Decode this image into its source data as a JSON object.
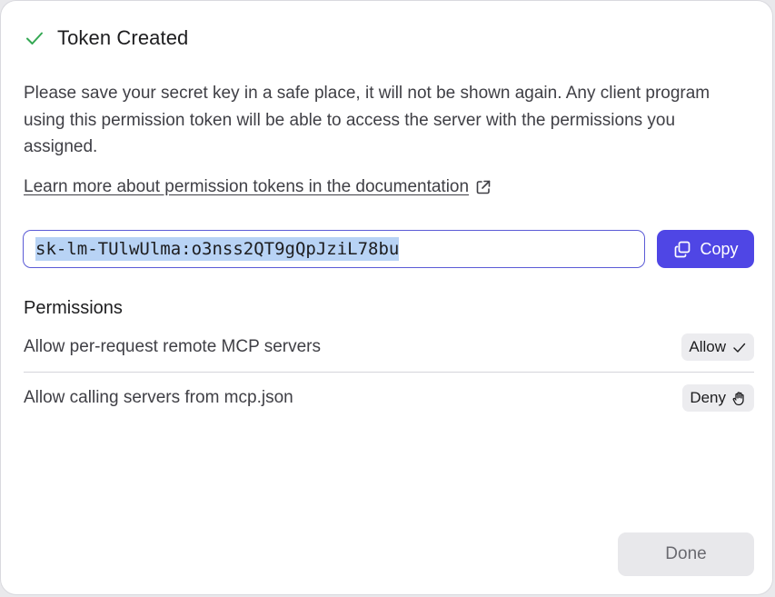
{
  "dialog": {
    "title": "Token Created",
    "title_icon": "check-icon",
    "description": "Please save your secret key in a safe place, it will not be shown again. Any client program using this permission token will be able to access the server with the permissions you assigned.",
    "doc_link": {
      "label": "Learn more about permission tokens in the documentation",
      "icon": "external-link-icon"
    },
    "token": {
      "value": "sk-lm-TUlwUlma:o3nss2QT9gQpJziL78bu",
      "selected": true
    },
    "copy_button": {
      "label": "Copy",
      "icon": "copy-icon"
    },
    "permissions": {
      "heading": "Permissions",
      "items": [
        {
          "label": "Allow per-request remote MCP servers",
          "value": "Allow",
          "icon": "checkmark-icon"
        },
        {
          "label": "Allow calling servers from mcp.json",
          "value": "Deny",
          "icon": "hand-stop-icon"
        }
      ]
    },
    "done_button": {
      "label": "Done"
    }
  },
  "colors": {
    "accent": "#4f46e5",
    "success": "#34a853",
    "selection": "#b8d3f5"
  }
}
